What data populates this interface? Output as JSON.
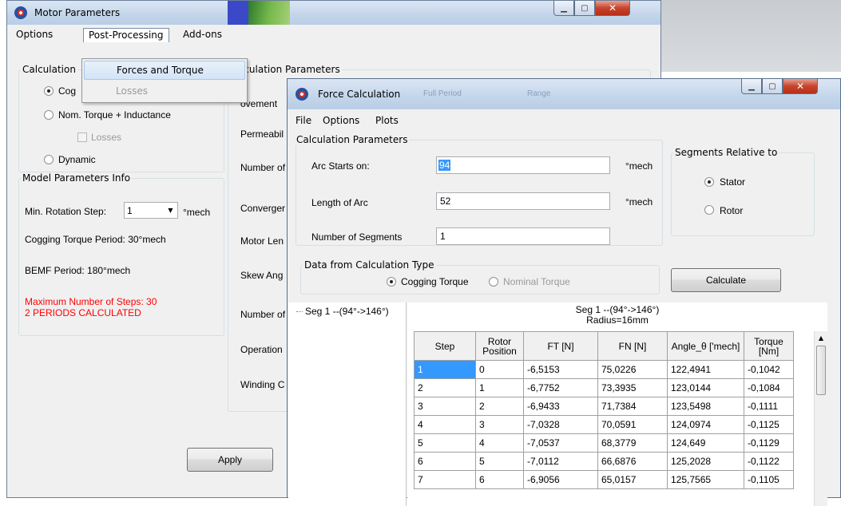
{
  "main_window": {
    "title": "Motor Parameters",
    "menu": [
      "Options",
      "Post-Processing",
      "Add-ons"
    ],
    "dropdown": [
      "Forces and Torque",
      "Losses"
    ],
    "calc_group": {
      "legend": "Calculation",
      "options": [
        "Cog",
        "Nom. Torque + Inductance",
        "Dynamic"
      ],
      "losses_label": "Losses"
    },
    "model_info": {
      "legend": "Model Parameters Info",
      "min_step_label": "Min. Rotation Step:",
      "min_step_value": "1",
      "min_step_unit": "°mech",
      "cogging_period": "Cogging Torque Period: 30°mech",
      "bemf_period": "BEMF Period: 180°mech",
      "max_steps_line1": "Maximum Number of Steps: 30",
      "max_steps_line2": "2 PERIODS CALCULATED"
    },
    "calc_params_legend": "lculation Parameters",
    "param_labels": [
      "ovement",
      "Permeabil",
      "Number of",
      "Converger",
      "Motor Len",
      "Skew Ang",
      "Number of",
      "Operation",
      "Winding C"
    ],
    "apply_label": "Apply"
  },
  "force_window": {
    "title": "Force Calculation",
    "faded_tabs": [
      "Full Period",
      "Range"
    ],
    "menu": [
      "File",
      "Options",
      "Plots"
    ],
    "calc_params": {
      "legend": "Calculation Parameters",
      "arc_start_label": "Arc Starts on:",
      "arc_start_value": "94",
      "arc_start_unit": "°mech",
      "arc_length_label": "Length of Arc",
      "arc_length_value": "52",
      "arc_length_unit": "°mech",
      "segments_label": "Number of Segments",
      "segments_value": "1"
    },
    "segments_relative": {
      "legend": "Segments Relative to",
      "options": [
        "Stator",
        "Rotor"
      ],
      "selected": "Stator"
    },
    "data_type": {
      "legend": "Data from Calculation Type",
      "options": [
        "Cogging Torque",
        "Nominal Torque"
      ],
      "selected": "Cogging Torque"
    },
    "calculate_label": "Calculate",
    "tree_item": "Seg 1 --(94°->146°)",
    "grid_title_line1": "Seg 1 --(94°->146°)",
    "grid_title_line2": "Radius=16mm",
    "columns": [
      "Step",
      "Rotor Position",
      "FT [N]",
      "FN [N]",
      "Angle_θ ['mech]",
      "Torque [Nm]"
    ],
    "rows": [
      [
        "1",
        "0",
        "-6,5153",
        "75,0226",
        "122,4941",
        "-0,1042"
      ],
      [
        "2",
        "1",
        "-6,7752",
        "73,3935",
        "123,0144",
        "-0,1084"
      ],
      [
        "3",
        "2",
        "-6,9433",
        "71,7384",
        "123,5498",
        "-0,1111"
      ],
      [
        "4",
        "3",
        "-7,0328",
        "70,0591",
        "124,0974",
        "-0,1125"
      ],
      [
        "5",
        "4",
        "-7,0537",
        "68,3779",
        "124,649",
        "-0,1129"
      ],
      [
        "6",
        "5",
        "-7,0112",
        "66,6876",
        "125,2028",
        "-0,1122"
      ],
      [
        "7",
        "6",
        "-6,9056",
        "65,0157",
        "125,7565",
        "-0,1105"
      ]
    ]
  }
}
